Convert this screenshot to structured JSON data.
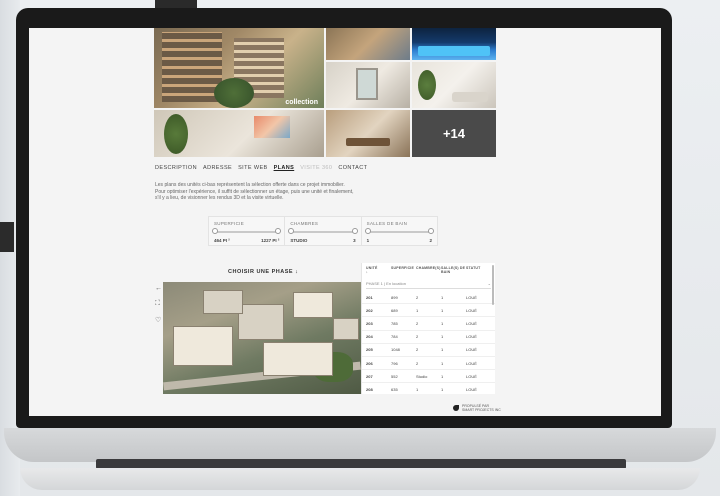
{
  "gallery": {
    "brand": "collection",
    "more_count": "+14"
  },
  "tabs": [
    {
      "label": "DESCRIPTION",
      "active": false
    },
    {
      "label": "ADRESSE",
      "active": false
    },
    {
      "label": "SITE WEB",
      "active": false
    },
    {
      "label": "PLANS",
      "active": true
    },
    {
      "label": "VISITE 360",
      "active": false
    },
    {
      "label": "CONTACT",
      "active": false
    }
  ],
  "description": "Les plans des unités ci-bas représentent la sélection offerte dans ce projet immobilier. Pour optimiser l'expérience, il suffit de sélectionner un étage, puis une unité et finalement, s'il y a lieu, de visionner les rendus 3D et la visite virtuelle.",
  "filters": {
    "superficie": {
      "label": "SUPERFICIE",
      "min": "464 PI ²",
      "max": "1227 PI ²"
    },
    "chambres": {
      "label": "CHAMBRES",
      "min": "STUDIO",
      "max": "3"
    },
    "salles": {
      "label": "SALLES DE BAIN",
      "min": "1",
      "max": "2"
    }
  },
  "phase": {
    "label": "CHOISIR UNE PHASE",
    "arrow": "↓"
  },
  "side_icons": {
    "back": "←",
    "expand": "⛶",
    "favorite": "♡"
  },
  "units": {
    "headers": [
      "UNITÉ",
      "SUPERFICIE",
      "CHAMBRE(S)",
      "SALLE(S) DE BAIN",
      "STATUT"
    ],
    "sort_arrow": "↓",
    "phase_select": "PHASE 1 | En location",
    "phase_chevron": "⌄",
    "rows": [
      [
        "201",
        "899",
        "2",
        "1",
        "LOUÉ"
      ],
      [
        "202",
        "689",
        "1",
        "1",
        "LOUÉ"
      ],
      [
        "203",
        "785",
        "2",
        "1",
        "LOUÉ"
      ],
      [
        "204",
        "784",
        "2",
        "1",
        "LOUÉ"
      ],
      [
        "205",
        "1048",
        "2",
        "1",
        "LOUÉ"
      ],
      [
        "206",
        "796",
        "2",
        "1",
        "LOUÉ"
      ],
      [
        "207",
        "552",
        "Studio",
        "1",
        "LOUÉ"
      ],
      [
        "208",
        "635",
        "1",
        "1",
        "LOUÉ"
      ]
    ]
  },
  "footer": {
    "line1": "PROPULSÉ PAR",
    "line2": "SMART PROJECTS INC"
  }
}
